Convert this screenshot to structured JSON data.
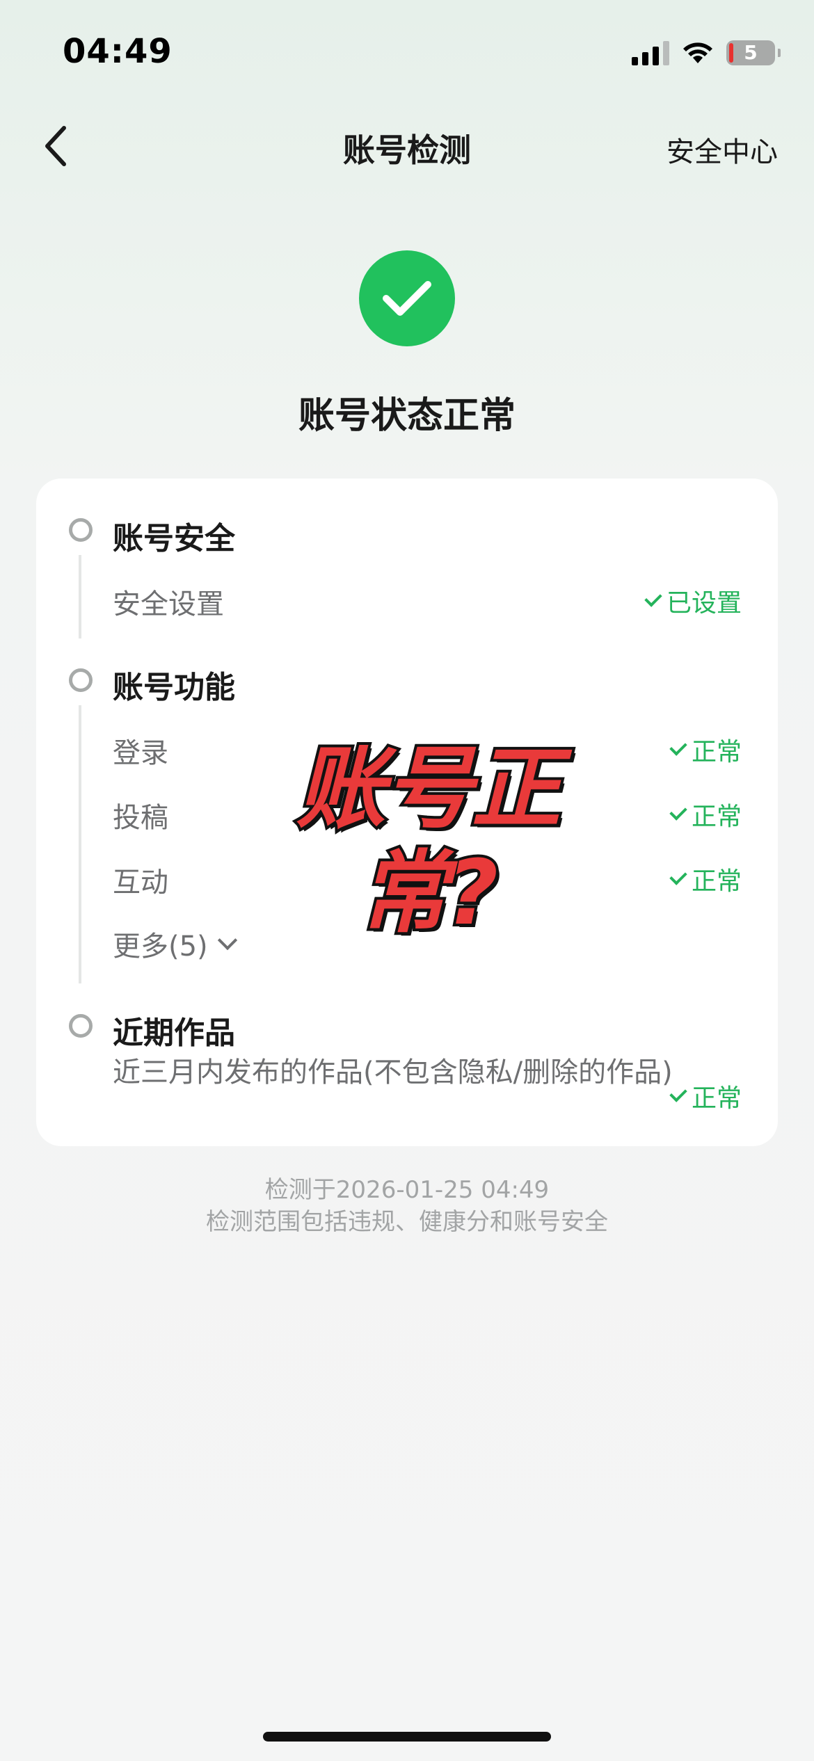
{
  "status_bar": {
    "time": "04:49",
    "battery_level": "5",
    "signal_bars": 3,
    "icons": [
      "signal-icon",
      "wifi-icon",
      "battery-icon"
    ]
  },
  "nav": {
    "back_icon": "chevron-left-icon",
    "title": "账号检测",
    "right_link": "安全中心"
  },
  "hero": {
    "icon": "check-circle-icon",
    "title": "账号状态正常",
    "accent_color": "#21c15d"
  },
  "sections": {
    "security": {
      "title": "账号安全",
      "items": [
        {
          "label": "安全设置",
          "status": "已设置"
        }
      ]
    },
    "functions": {
      "title": "账号功能",
      "items": [
        {
          "label": "登录",
          "status": "正常"
        },
        {
          "label": "投稿",
          "status": "正常"
        },
        {
          "label": "互动",
          "status": "正常"
        }
      ],
      "more_label": "更多(5)"
    },
    "works": {
      "title": "近期作品",
      "description": "近三月内发布的作品(不包含隐私/删除的作品)",
      "status": "正常"
    }
  },
  "overlay_text": "账号正常?",
  "footer": {
    "checked_at": "检测于2026-01-25 04:49",
    "scope": "检测范围包括违规、健康分和账号安全"
  },
  "colors": {
    "status_green": "#24b35b",
    "overlay_red": "#e93a3a"
  }
}
